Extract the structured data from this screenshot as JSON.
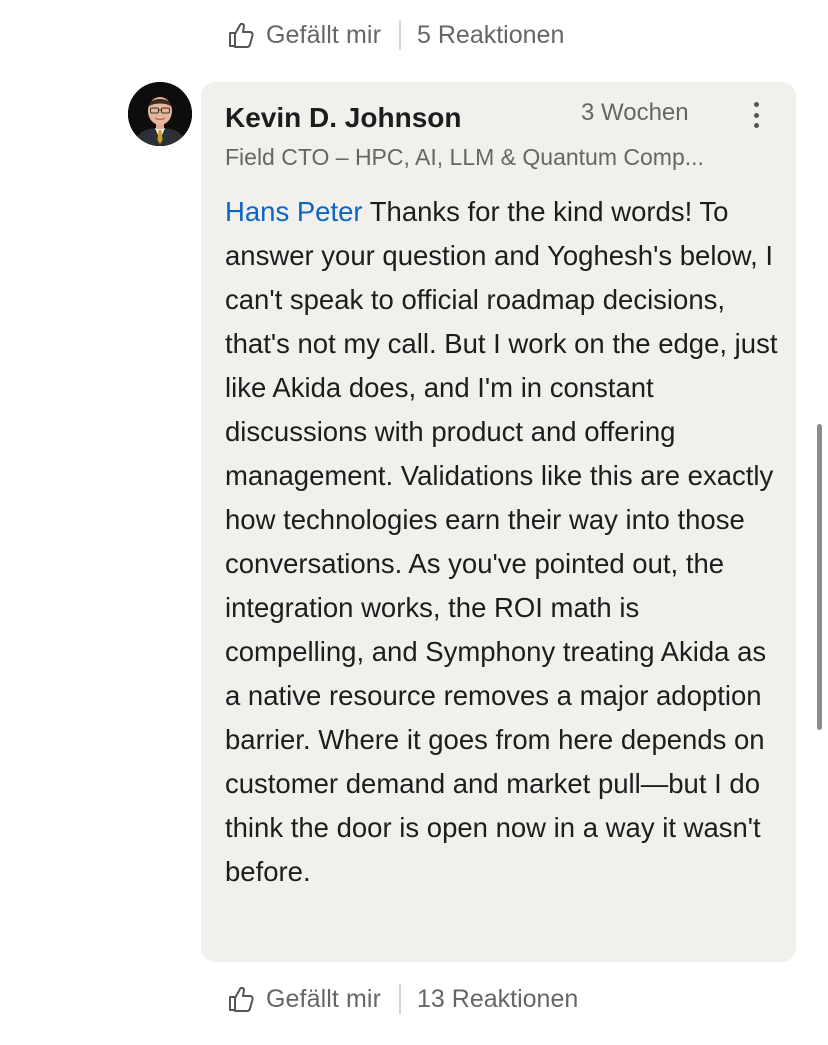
{
  "top_actions": {
    "like_label": "Gefällt mir",
    "reactions_label": "5 Reaktionen"
  },
  "comment": {
    "author_name": "Kevin D. Johnson",
    "timestamp": "3 Wochen",
    "author_headline": "Field CTO – HPC, AI, LLM & Quantum Comp...",
    "mention": "Hans Peter",
    "text": " Thanks for the kind words! To answer your question and Yoghesh's below, I can't speak to official roadmap decisions, that's not my call. But I work on the edge, just like Akida does, and I'm in constant discussions with product and offering management. Validations like this are exactly how technologies earn their way into those conversations. As you've pointed out, the integration works, the ROI math is compelling, and Symphony treating Akida as a native resource removes a major adoption barrier. Where it goes from here depends on customer demand and market pull—but I do think the door is open now in a way it wasn't before."
  },
  "bottom_actions": {
    "like_label": "Gefällt mir",
    "reactions_label": "13 Reaktionen"
  },
  "icons": {
    "like": "thumbs-up-outline-icon",
    "more": "more-vertical-icon"
  },
  "colors": {
    "mention": "#0a66c2",
    "bubble_background": "#f2f0ed",
    "secondary_text": "#666666"
  }
}
